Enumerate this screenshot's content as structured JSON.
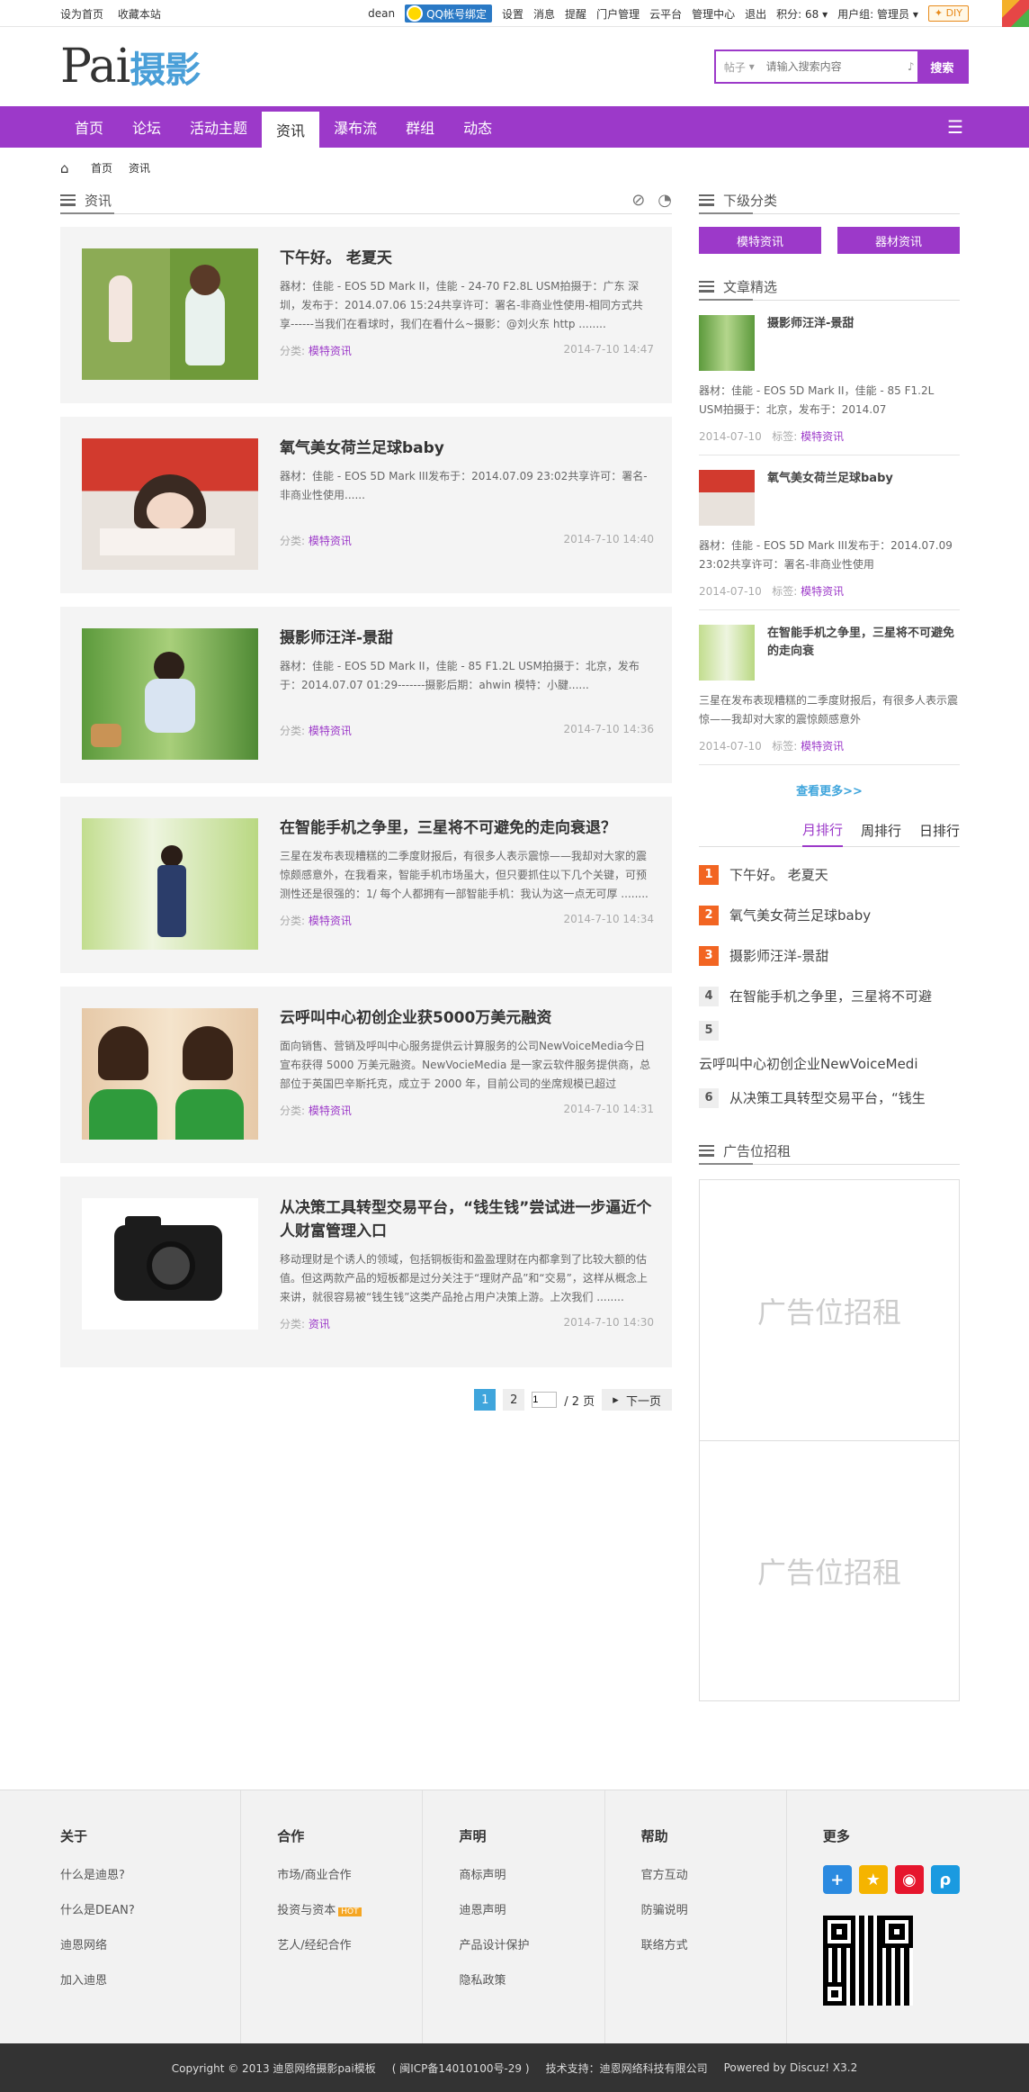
{
  "topbar": {
    "left": [
      "设为首页",
      "收藏本站"
    ],
    "user": "dean",
    "qq_label": "QQ帐号绑定",
    "links": [
      "设置",
      "消息",
      "提醒",
      "门户管理",
      "云平台",
      "管理中心",
      "退出"
    ],
    "points": "积分: 68",
    "group": "用户组: 管理员",
    "diy": "DIY"
  },
  "header": {
    "logo_en": "Pai",
    "logo_cn": "摄影",
    "search_type": "帖子",
    "search_placeholder": "请输入搜索内容",
    "search_button": "搜索"
  },
  "nav": {
    "items": [
      "首页",
      "论坛",
      "活动主题",
      "资讯",
      "瀑布流",
      "群组",
      "动态"
    ],
    "active_index": 3
  },
  "breadcrumb": [
    "首页",
    "资讯"
  ],
  "main": {
    "section_title": "资讯",
    "posts": [
      {
        "title": "下午好。 老夏天",
        "desc": "器材：佳能 - EOS 5D Mark II，佳能 - 24-70 F2.8L USM拍摄于：广东 深圳，发布于：2014.07.06 15:24共享许可：署名-非商业性使用-相同方式共享------当我们在看球时，我们在看什么~摄影：@刘火东 http ........",
        "cat_label": "分类:",
        "cat": "模特资讯",
        "time": "2014-7-10 14:47"
      },
      {
        "title": "氧气美女荷兰足球baby",
        "desc": "器材：佳能 - EOS 5D Mark III发布于：2014.07.09 23:02共享许可：署名-非商业性使用......",
        "cat_label": "分类:",
        "cat": "模特资讯",
        "time": "2014-7-10 14:40"
      },
      {
        "title": "摄影师汪洋-景甜",
        "desc": "器材：佳能 - EOS 5D Mark II，佳能 - 85 F1.2L USM拍摄于：北京，发布于：2014.07.07 01:29-------摄影后期：ahwin 模特：小腱......",
        "cat_label": "分类:",
        "cat": "模特资讯",
        "time": "2014-7-10 14:36"
      },
      {
        "title": "在智能手机之争里，三星将不可避免的走向衰退？",
        "desc": "三星在发布表现糟糕的二季度财报后，有很多人表示震惊——我却对大家的震惊颇感意外，在我看来，智能手机市场虽大，但只要抓住以下几个关键，可预测性还是很强的：1/ 每个人都拥有一部智能手机：我认为这一点无可厚 ........",
        "cat_label": "分类:",
        "cat": "模特资讯",
        "time": "2014-7-10 14:34"
      },
      {
        "title": "云呼叫中心初创企业获5000万美元融资",
        "desc": "面向销售、营销及呼叫中心服务提供云计算服务的公司NewVoiceMedia今日宣布获得 5000 万美元融资。NewVocieMedia 是一家云软件服务提供商，总部位于英国巴辛斯托克，成立于 2000 年，目前公司的坐席规模已超过 13000 个。NewV ........",
        "cat_label": "分类:",
        "cat": "模特资讯",
        "time": "2014-7-10 14:31"
      },
      {
        "title": "从决策工具转型交易平台，“钱生钱”尝试进一步逼近个人财富管理入口",
        "desc": "移动理财是个诱人的领域，包括铜板街和盈盈理财在内都拿到了比较大额的估值。但这两款产品的短板都是过分关注于“理财产品”和“交易”，这样从概念上来讲，就很容易被“钱生钱”这类产品抢占用户决策上游。上次我们 ........",
        "cat_label": "分类:",
        "cat": "资讯",
        "time": "2014-7-10 14:30"
      }
    ],
    "pager": {
      "pages": [
        "1",
        "2"
      ],
      "current": "1",
      "input": "1",
      "total": "/ 2 页",
      "next": "下一页"
    }
  },
  "side": {
    "subcat_title": "下级分类",
    "subcats": [
      "模特资讯",
      "器材资讯"
    ],
    "featured_title": "文章精选",
    "featured": [
      {
        "title": "摄影师汪洋-景甜",
        "desc": "器材：佳能 - EOS 5D Mark II，佳能 - 85 F1.2L USM拍摄于：北京，发布于：2014.07",
        "date": "2014-07-10",
        "tag_label": "标签:",
        "tag": "模特资讯"
      },
      {
        "title": "氧气美女荷兰足球baby",
        "desc": "器材：佳能 - EOS 5D Mark III发布于：2014.07.09 23:02共享许可：署名-非商业性使用",
        "date": "2014-07-10",
        "tag_label": "标签:",
        "tag": "模特资讯"
      },
      {
        "title": "在智能手机之争里，三星将不可避免的走向衰",
        "desc": "三星在发布表现糟糕的二季度财报后，有很多人表示震惊——我却对大家的震惊颇感意外",
        "date": "2014-07-10",
        "tag_label": "标签:",
        "tag": "模特资讯"
      }
    ],
    "more": "查看更多>>",
    "rank_tabs": [
      "月排行",
      "周排行",
      "日排行"
    ],
    "rank": [
      {
        "n": "1",
        "t": "下午好。 老夏天"
      },
      {
        "n": "2",
        "t": "氧气美女荷兰足球baby"
      },
      {
        "n": "3",
        "t": "摄影师汪洋-景甜"
      },
      {
        "n": "4",
        "t": "在智能手机之争里，三星将不可避"
      },
      {
        "n": "5",
        "t": "云呼叫中心初创企业NewVoiceMedi"
      },
      {
        "n": "6",
        "t": "从决策工具转型交易平台，“钱生"
      }
    ],
    "ads_title": "广告位招租",
    "ads": [
      "广告位招租",
      "广告位招租"
    ]
  },
  "footer": {
    "cols": [
      {
        "title": "关于",
        "links": [
          "什么是迪恩?",
          "什么是DEAN?",
          "迪恩网络",
          "加入迪恩"
        ]
      },
      {
        "title": "合作",
        "links": [
          "市场/商业合作",
          "投资与资本",
          "艺人/经纪合作"
        ]
      },
      {
        "title": "声明",
        "links": [
          "商标声明",
          "迪恩声明",
          "产品设计保护",
          "隐私政策"
        ]
      },
      {
        "title": "帮助",
        "links": [
          "官方互动",
          "防骗说明",
          "联络方式"
        ]
      }
    ],
    "more_title": "更多",
    "hot_badge": "HOT",
    "copyright": "Copyright © 2013 迪恩网络摄影pai模板",
    "icp": "( 闽ICP备14010100号-29 )",
    "support": "技术支持：迪恩网络科技有限公司",
    "powered": "Powered by Discuz! X3.2"
  }
}
